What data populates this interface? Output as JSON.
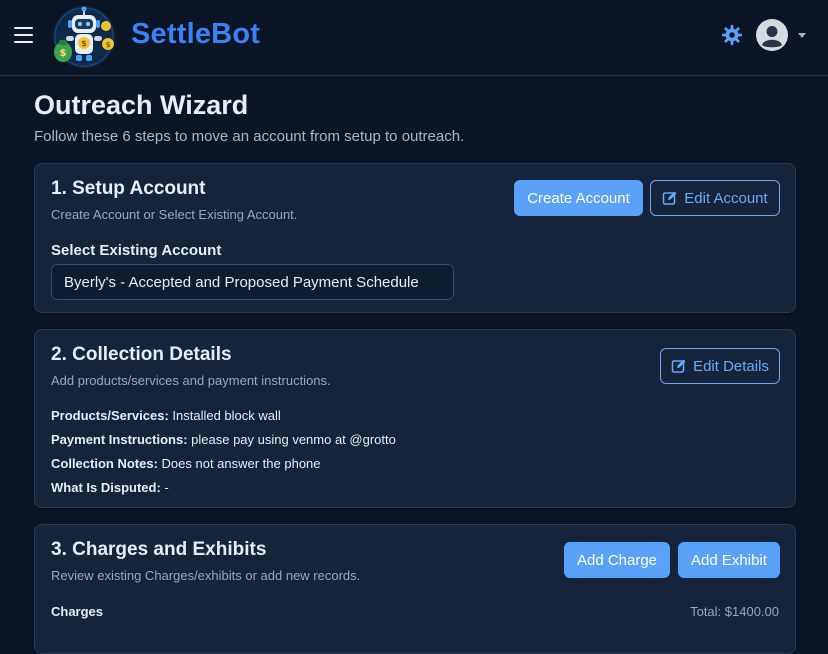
{
  "app": {
    "brand": "SettleBot"
  },
  "page": {
    "title": "Outreach Wizard",
    "subtitle": "Follow these 6 steps to move an account from setup to outreach."
  },
  "steps": [
    {
      "title": "1. Setup Account",
      "subtitle": "Create Account or Select Existing Account.",
      "primary_button": "Create Account",
      "outline_button": "Edit Account",
      "field_label": "Select Existing Account",
      "selected_account": "Byerly's - Accepted and Proposed Payment Schedule"
    },
    {
      "title": "2. Collection Details",
      "subtitle": "Add products/services and payment instructions.",
      "outline_button": "Edit Details",
      "details": [
        {
          "label": "Products/Services:",
          "value": " Installed block wall"
        },
        {
          "label": "Payment Instructions:",
          "value": " please pay using venmo at @grotto"
        },
        {
          "label": "Collection Notes:",
          "value": " Does not answer the phone"
        },
        {
          "label": "What Is Disputed:",
          "value": " -"
        }
      ]
    },
    {
      "title": "3. Charges and Exhibits",
      "subtitle": "Review existing Charges/exhibits or add new records.",
      "primary_button_1": "Add Charge",
      "primary_button_2": "Add Exhibit",
      "charges_label": "Charges",
      "total": "Total: $1400.00"
    }
  ],
  "colors": {
    "background": "#0b1526",
    "card": "#15233b",
    "accent": "#3b82f6",
    "button_primary": "#5aa2f7"
  },
  "icons": {
    "menu": "hamburger-icon",
    "settings": "gear-icon",
    "user": "user-avatar-icon",
    "edit": "edit-icon"
  }
}
